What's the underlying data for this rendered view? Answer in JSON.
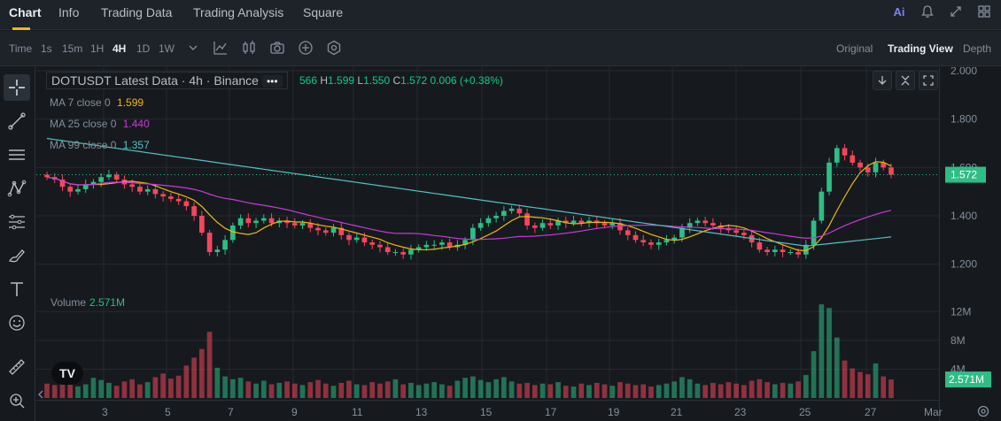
{
  "tabs": [
    {
      "label": "Chart",
      "active": true
    },
    {
      "label": "Info"
    },
    {
      "label": "Trading Data"
    },
    {
      "label": "Trading Analysis"
    },
    {
      "label": "Square"
    }
  ],
  "top_icons": {
    "ai_label": "Ai"
  },
  "toolbar": {
    "time_label": "Time",
    "intervals": [
      "1s",
      "15m",
      "1H",
      "4H",
      "1D",
      "1W"
    ],
    "active_interval": "4H",
    "views": [
      "Original",
      "Trading View",
      "Depth"
    ],
    "active_view": "Trading View"
  },
  "legend": {
    "title": "DOTUSDT Latest Data · 4h · Binance",
    "dots": "•••",
    "ohlc_partial_open": "566",
    "high_label": "H",
    "high": "1.599",
    "low_label": "L",
    "low": "1.550",
    "close_label": "C",
    "close": "1.572",
    "change": "0.006 (+0.38%)",
    "ma7_label": "MA 7 close 0",
    "ma7_value": "1.599",
    "ma25_label": "MA 25 close 0",
    "ma25_value": "1.440",
    "ma99_label": "MA 99 close 0",
    "ma99_value": "1.357"
  },
  "volume": {
    "label": "Volume",
    "value": "2.571M"
  },
  "price_axis": {
    "ticks": [
      "2.000",
      "1.800",
      "1.600",
      "1.400",
      "1.200"
    ],
    "current_price": "1.572",
    "volume_ticks": [
      "12M",
      "8M",
      "4M"
    ],
    "current_volume": "2.571M"
  },
  "x_axis": {
    "ticks": [
      "3",
      "5",
      "7",
      "9",
      "11",
      "13",
      "15",
      "17",
      "19",
      "21",
      "23",
      "25",
      "27",
      "Mar"
    ]
  },
  "logo_text": "TV",
  "colors": {
    "up": "#2ebd85",
    "down": "#f6465d",
    "ma7": "#f0b90b",
    "ma25": "#c83ad8",
    "ma99": "#56c0c6"
  },
  "chart_data": {
    "type": "candlestick",
    "pair": "DOTUSDT",
    "interval": "4h",
    "ylim": [
      1.1,
      2.0
    ],
    "volume_ylim": [
      0,
      14
    ],
    "closes": [
      1.56,
      1.55,
      1.52,
      1.5,
      1.51,
      1.53,
      1.54,
      1.56,
      1.57,
      1.55,
      1.53,
      1.52,
      1.5,
      1.51,
      1.49,
      1.48,
      1.47,
      1.46,
      1.44,
      1.4,
      1.33,
      1.25,
      1.26,
      1.3,
      1.36,
      1.39,
      1.37,
      1.38,
      1.39,
      1.37,
      1.38,
      1.37,
      1.36,
      1.37,
      1.35,
      1.34,
      1.33,
      1.35,
      1.32,
      1.3,
      1.31,
      1.29,
      1.28,
      1.27,
      1.25,
      1.25,
      1.24,
      1.26,
      1.27,
      1.28,
      1.28,
      1.29,
      1.27,
      1.28,
      1.3,
      1.35,
      1.37,
      1.39,
      1.4,
      1.42,
      1.43,
      1.41,
      1.36,
      1.35,
      1.37,
      1.36,
      1.38,
      1.37,
      1.38,
      1.37,
      1.38,
      1.37,
      1.36,
      1.37,
      1.34,
      1.32,
      1.3,
      1.29,
      1.28,
      1.29,
      1.3,
      1.31,
      1.35,
      1.37,
      1.38,
      1.37,
      1.36,
      1.35,
      1.34,
      1.33,
      1.32,
      1.29,
      1.26,
      1.25,
      1.26,
      1.25,
      1.25,
      1.24,
      1.28,
      1.38,
      1.5,
      1.62,
      1.68,
      1.65,
      1.62,
      1.6,
      1.58,
      1.62,
      1.6,
      1.57
    ],
    "volumes": [
      2.0,
      1.8,
      2.2,
      2.4,
      1.6,
      1.9,
      2.8,
      2.5,
      2.1,
      1.7,
      2.3,
      2.6,
      1.9,
      2.2,
      2.9,
      3.4,
      2.7,
      3.1,
      4.5,
      5.6,
      6.8,
      9.2,
      4.2,
      3.0,
      2.6,
      2.8,
      2.3,
      2.0,
      2.4,
      1.9,
      2.1,
      2.3,
      2.0,
      1.8,
      2.2,
      2.5,
      2.0,
      1.7,
      2.1,
      2.4,
      1.9,
      1.8,
      2.2,
      2.0,
      2.3,
      2.6,
      1.9,
      2.1,
      1.8,
      2.0,
      2.2,
      1.9,
      1.7,
      2.4,
      2.8,
      3.0,
      2.5,
      2.2,
      2.6,
      2.9,
      2.3,
      2.0,
      2.1,
      1.8,
      2.0,
      1.9,
      2.2,
      1.7,
      1.6,
      2.0,
      1.8,
      2.1,
      1.9,
      1.7,
      2.2,
      2.0,
      1.8,
      1.9,
      1.6,
      1.8,
      2.0,
      2.3,
      2.9,
      2.6,
      2.0,
      1.8,
      2.1,
      1.9,
      2.2,
      2.0,
      1.8,
      2.4,
      2.6,
      2.2,
      1.9,
      2.1,
      2.0,
      2.3,
      3.2,
      6.5,
      13.0,
      12.5,
      8.4,
      5.2,
      4.1,
      3.6,
      3.3,
      4.8,
      3.0,
      2.571
    ]
  }
}
